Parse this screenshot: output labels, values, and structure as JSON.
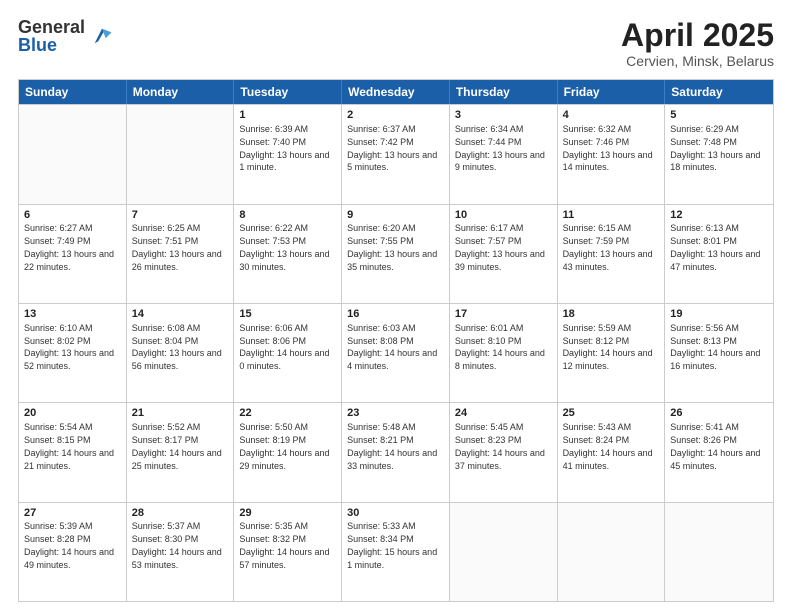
{
  "header": {
    "logo_general": "General",
    "logo_blue": "Blue",
    "month_title": "April 2025",
    "location": "Cervien, Minsk, Belarus"
  },
  "days_of_week": [
    "Sunday",
    "Monday",
    "Tuesday",
    "Wednesday",
    "Thursday",
    "Friday",
    "Saturday"
  ],
  "weeks": [
    [
      {
        "day": "",
        "text": ""
      },
      {
        "day": "",
        "text": ""
      },
      {
        "day": "1",
        "text": "Sunrise: 6:39 AM\nSunset: 7:40 PM\nDaylight: 13 hours and 1 minute."
      },
      {
        "day": "2",
        "text": "Sunrise: 6:37 AM\nSunset: 7:42 PM\nDaylight: 13 hours and 5 minutes."
      },
      {
        "day": "3",
        "text": "Sunrise: 6:34 AM\nSunset: 7:44 PM\nDaylight: 13 hours and 9 minutes."
      },
      {
        "day": "4",
        "text": "Sunrise: 6:32 AM\nSunset: 7:46 PM\nDaylight: 13 hours and 14 minutes."
      },
      {
        "day": "5",
        "text": "Sunrise: 6:29 AM\nSunset: 7:48 PM\nDaylight: 13 hours and 18 minutes."
      }
    ],
    [
      {
        "day": "6",
        "text": "Sunrise: 6:27 AM\nSunset: 7:49 PM\nDaylight: 13 hours and 22 minutes."
      },
      {
        "day": "7",
        "text": "Sunrise: 6:25 AM\nSunset: 7:51 PM\nDaylight: 13 hours and 26 minutes."
      },
      {
        "day": "8",
        "text": "Sunrise: 6:22 AM\nSunset: 7:53 PM\nDaylight: 13 hours and 30 minutes."
      },
      {
        "day": "9",
        "text": "Sunrise: 6:20 AM\nSunset: 7:55 PM\nDaylight: 13 hours and 35 minutes."
      },
      {
        "day": "10",
        "text": "Sunrise: 6:17 AM\nSunset: 7:57 PM\nDaylight: 13 hours and 39 minutes."
      },
      {
        "day": "11",
        "text": "Sunrise: 6:15 AM\nSunset: 7:59 PM\nDaylight: 13 hours and 43 minutes."
      },
      {
        "day": "12",
        "text": "Sunrise: 6:13 AM\nSunset: 8:01 PM\nDaylight: 13 hours and 47 minutes."
      }
    ],
    [
      {
        "day": "13",
        "text": "Sunrise: 6:10 AM\nSunset: 8:02 PM\nDaylight: 13 hours and 52 minutes."
      },
      {
        "day": "14",
        "text": "Sunrise: 6:08 AM\nSunset: 8:04 PM\nDaylight: 13 hours and 56 minutes."
      },
      {
        "day": "15",
        "text": "Sunrise: 6:06 AM\nSunset: 8:06 PM\nDaylight: 14 hours and 0 minutes."
      },
      {
        "day": "16",
        "text": "Sunrise: 6:03 AM\nSunset: 8:08 PM\nDaylight: 14 hours and 4 minutes."
      },
      {
        "day": "17",
        "text": "Sunrise: 6:01 AM\nSunset: 8:10 PM\nDaylight: 14 hours and 8 minutes."
      },
      {
        "day": "18",
        "text": "Sunrise: 5:59 AM\nSunset: 8:12 PM\nDaylight: 14 hours and 12 minutes."
      },
      {
        "day": "19",
        "text": "Sunrise: 5:56 AM\nSunset: 8:13 PM\nDaylight: 14 hours and 16 minutes."
      }
    ],
    [
      {
        "day": "20",
        "text": "Sunrise: 5:54 AM\nSunset: 8:15 PM\nDaylight: 14 hours and 21 minutes."
      },
      {
        "day": "21",
        "text": "Sunrise: 5:52 AM\nSunset: 8:17 PM\nDaylight: 14 hours and 25 minutes."
      },
      {
        "day": "22",
        "text": "Sunrise: 5:50 AM\nSunset: 8:19 PM\nDaylight: 14 hours and 29 minutes."
      },
      {
        "day": "23",
        "text": "Sunrise: 5:48 AM\nSunset: 8:21 PM\nDaylight: 14 hours and 33 minutes."
      },
      {
        "day": "24",
        "text": "Sunrise: 5:45 AM\nSunset: 8:23 PM\nDaylight: 14 hours and 37 minutes."
      },
      {
        "day": "25",
        "text": "Sunrise: 5:43 AM\nSunset: 8:24 PM\nDaylight: 14 hours and 41 minutes."
      },
      {
        "day": "26",
        "text": "Sunrise: 5:41 AM\nSunset: 8:26 PM\nDaylight: 14 hours and 45 minutes."
      }
    ],
    [
      {
        "day": "27",
        "text": "Sunrise: 5:39 AM\nSunset: 8:28 PM\nDaylight: 14 hours and 49 minutes."
      },
      {
        "day": "28",
        "text": "Sunrise: 5:37 AM\nSunset: 8:30 PM\nDaylight: 14 hours and 53 minutes."
      },
      {
        "day": "29",
        "text": "Sunrise: 5:35 AM\nSunset: 8:32 PM\nDaylight: 14 hours and 57 minutes."
      },
      {
        "day": "30",
        "text": "Sunrise: 5:33 AM\nSunset: 8:34 PM\nDaylight: 15 hours and 1 minute."
      },
      {
        "day": "",
        "text": ""
      },
      {
        "day": "",
        "text": ""
      },
      {
        "day": "",
        "text": ""
      }
    ]
  ]
}
